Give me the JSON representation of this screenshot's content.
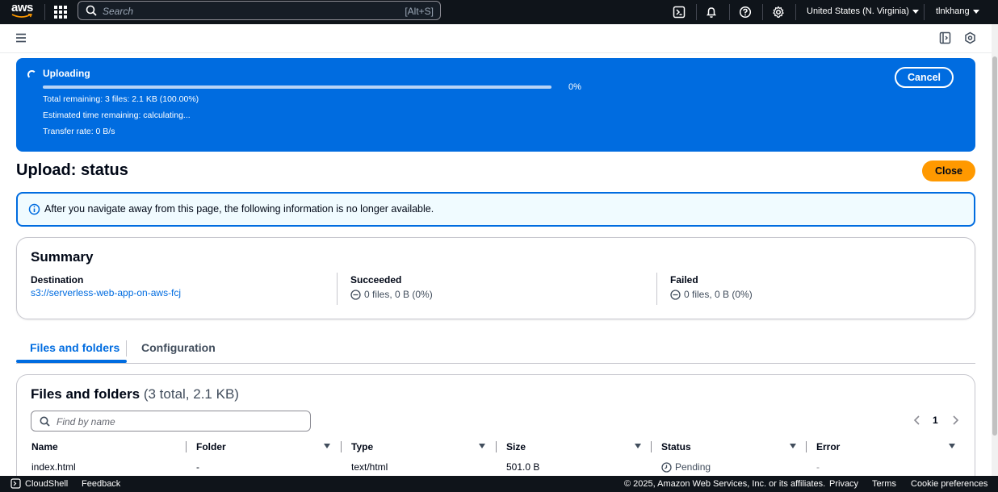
{
  "topnav": {
    "logo": "aws",
    "search_placeholder": "Search",
    "search_shortcut": "[Alt+S]",
    "region": "United States (N. Virginia)",
    "user": "tlnkhang"
  },
  "flash": {
    "title": "Uploading",
    "progress_percent": 0,
    "progress_label": "0%",
    "total_remaining": "Total remaining: 3 files: 2.1 KB (100.00%)",
    "estimated_time": "Estimated time remaining: calculating...",
    "transfer_rate": "Transfer rate: 0 B/s",
    "cancel_label": "Cancel"
  },
  "page": {
    "title": "Upload: status",
    "close_label": "Close",
    "info_message": "After you navigate away from this page, the following information is no longer available."
  },
  "summary": {
    "heading": "Summary",
    "destination_label": "Destination",
    "destination_value": "s3://serverless-web-app-on-aws-fcj",
    "succeeded_label": "Succeeded",
    "succeeded_value": "0 files, 0 B (0%)",
    "failed_label": "Failed",
    "failed_value": "0 files, 0 B (0%)"
  },
  "tabs": [
    {
      "label": "Files and folders",
      "active": true
    },
    {
      "label": "Configuration",
      "active": false
    }
  ],
  "files_table": {
    "heading": "Files and folders",
    "count": "(3 total, 2.1 KB)",
    "filter_placeholder": "Find by name",
    "page_number": "1",
    "columns": [
      "Name",
      "Folder",
      "Type",
      "Size",
      "Status",
      "Error"
    ],
    "rows": [
      {
        "name": "index.html",
        "folder": "-",
        "type": "text/html",
        "size": "501.0 B",
        "status": "Pending",
        "error": "-"
      }
    ]
  },
  "footer": {
    "cloudshell": "CloudShell",
    "feedback": "Feedback",
    "copyright": "© 2025, Amazon Web Services, Inc. or its affiliates.",
    "privacy": "Privacy",
    "terms": "Terms",
    "cookie": "Cookie preferences"
  },
  "colors": {
    "nav_bg": "#0f141a",
    "flash_blue": "#006ce0",
    "primary_orange": "#ff9900",
    "link_blue": "#006ce0"
  }
}
